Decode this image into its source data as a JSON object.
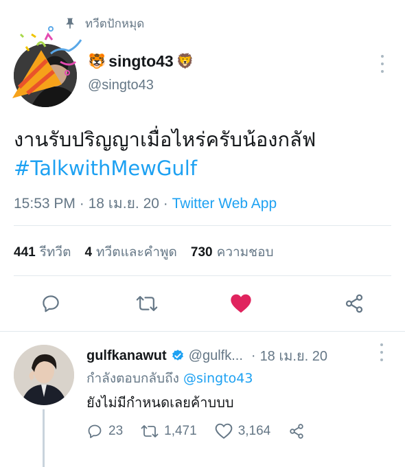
{
  "pinned": {
    "label": "ทวีตปักหมุด",
    "icon": "pin-icon"
  },
  "author": {
    "name": "singto43",
    "emoji_left": "🐯",
    "emoji_right": "🦁",
    "handle": "@singto43"
  },
  "tweet": {
    "text": "งานรับปริญญาเมื่อไหร่ครับน้องกลัฟ",
    "hashtag": "#TalkwithMewGulf",
    "time": "15:53 PM",
    "date": "18 เม.ย. 20",
    "source": "Twitter Web App"
  },
  "stats": {
    "retweets_count": "441",
    "retweets_label": "รีทวีต",
    "quotes_count": "4",
    "quotes_label": "ทวีตและคำพูด",
    "likes_count": "730",
    "likes_label": "ความชอบ"
  },
  "actions": [
    "reply-icon",
    "retweet-icon",
    "heart-icon",
    "share-icon"
  ],
  "reply": {
    "name": "gulfkanawut",
    "handle": "@gulfk...",
    "date": "18 เม.ย. 20",
    "replying_to_label": "กำลังตอบกลับถึง",
    "replying_to_handle": "@singto43",
    "text": "ยังไม่มีกำหนดเลยค้าบบบ",
    "reply_count": "23",
    "retweet_count": "1,471",
    "like_count": "3,164"
  },
  "colors": {
    "accent": "#1da1f2",
    "like": "#e0245e",
    "secondary_text": "#657786",
    "divider": "#e1e8ed"
  }
}
